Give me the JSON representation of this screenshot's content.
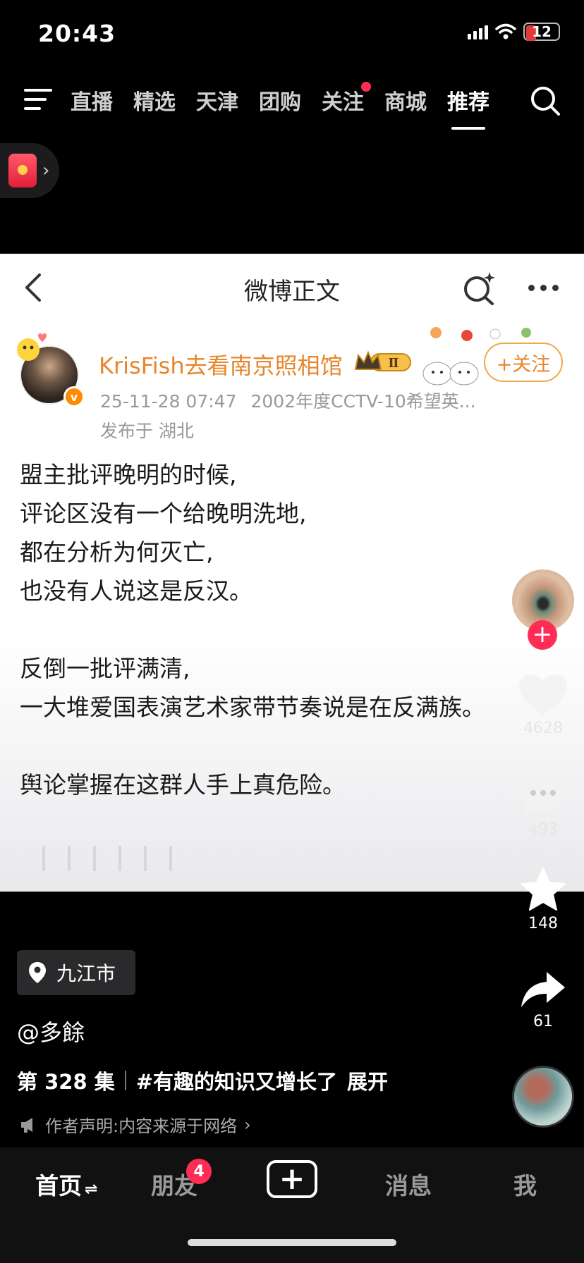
{
  "status_bar": {
    "time": "20:43",
    "battery": "12"
  },
  "top_nav": {
    "tabs": [
      {
        "label": "直播",
        "active": false,
        "dot": false
      },
      {
        "label": "精选",
        "active": false,
        "dot": false
      },
      {
        "label": "天津",
        "active": false,
        "dot": false
      },
      {
        "label": "团购",
        "active": false,
        "dot": false
      },
      {
        "label": "关注",
        "active": false,
        "dot": true
      },
      {
        "label": "商城",
        "active": false,
        "dot": false
      },
      {
        "label": "推荐",
        "active": true,
        "dot": false
      }
    ]
  },
  "card": {
    "title": "微博正文",
    "author": {
      "name": "KrisFish去看南京照相馆",
      "verified_badge": "v",
      "level_badge": "Ⅱ",
      "timestamp": "25-11-28 07:47",
      "source": "2002年度CCTV-10希望英...",
      "location": "发布于 湖北"
    },
    "follow_label": "+关注",
    "body_lines": [
      "盟主批评晚明的时候,",
      "评论区没有一个给晚明洗地,",
      "都在分析为何灭亡,",
      "也没有人说这是反汉。",
      "",
      "反倒一批评满清,",
      "一大堆爱国表演艺术家带节奏说是在反满族。",
      "",
      "舆论掌握在这群人手上真危险。"
    ]
  },
  "actions": {
    "likes": "4628",
    "comments": "493",
    "favorites": "148",
    "shares": "61"
  },
  "video_info": {
    "location_chip": "九江市",
    "handle": "@多餘",
    "episode": "第 328 集",
    "hashtag": "#有趣的知识又增长了",
    "expand": "展开",
    "declaration": "作者声明:内容来源于网络"
  },
  "tabbar": {
    "home": "首页",
    "friends": "朋友",
    "friends_badge": "4",
    "add": "+",
    "messages": "消息",
    "me": "我"
  },
  "colors": {
    "accent_red": "#ff2d55",
    "username_orange": "#e8852d",
    "follow_border": "#f0a84a"
  }
}
